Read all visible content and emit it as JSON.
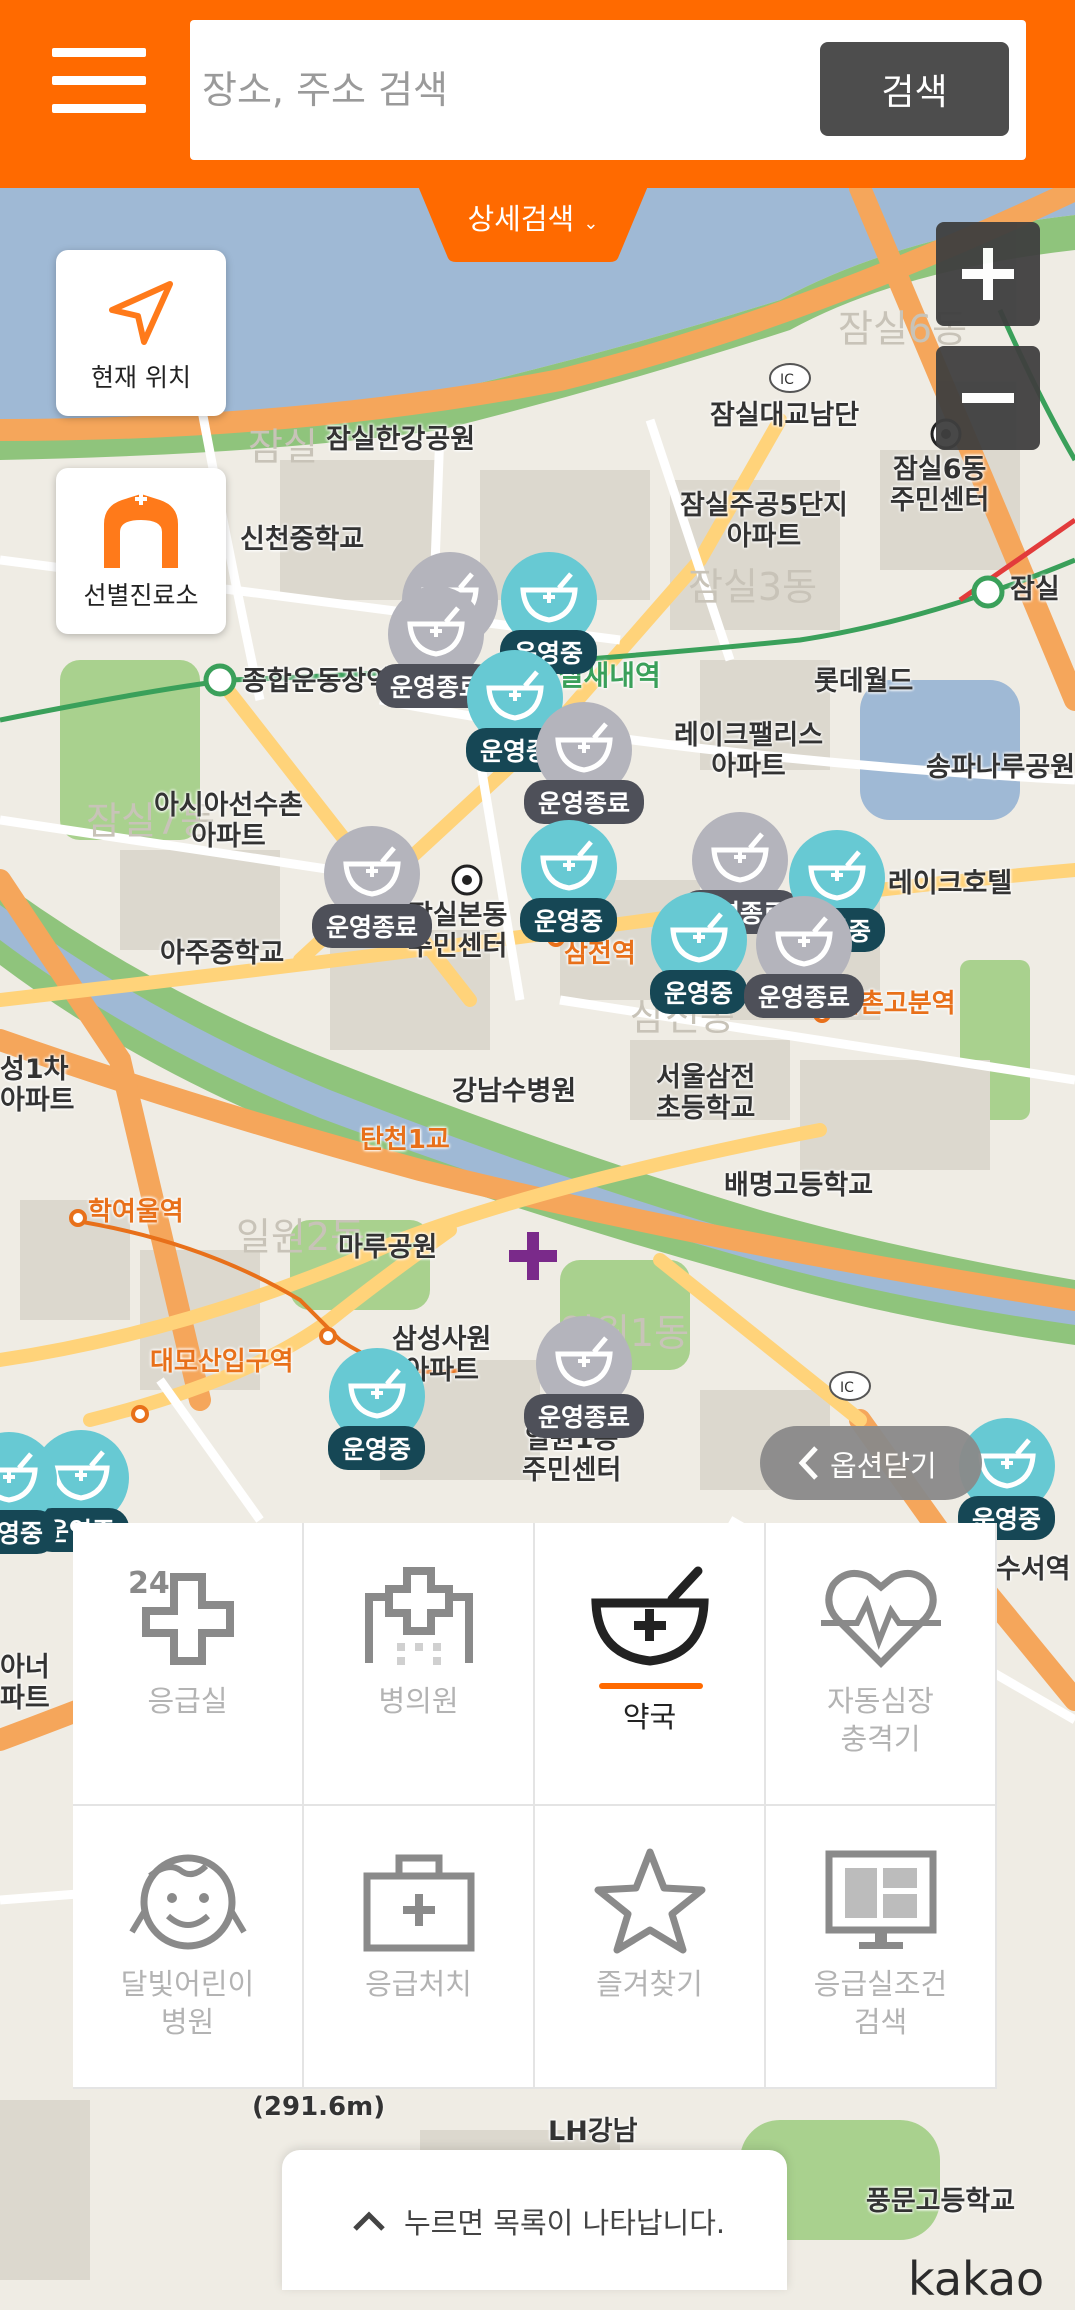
{
  "header": {
    "menu_icon": "hamburger-menu-icon",
    "search_placeholder": "장소, 주소 검색",
    "search_button": "검색",
    "detail_search": "상세검색"
  },
  "controls": {
    "current_location": "현재 위치",
    "screening_clinic": "선별진료소",
    "zoom_in": "+",
    "zoom_out": "−",
    "option_close": "옵션닫기"
  },
  "map": {
    "labels": [
      "잠실한강공원",
      "잠실대교남단",
      "잠실6동\n주민센터",
      "신천중학교",
      "잠실주공5단지\n아파트",
      "종합운동장역",
      "잠실새내역",
      "롯데월드",
      "레이크팰리스\n아파트",
      "송파나루공원",
      "아시아선수촌\n아파트",
      "레이크호텔",
      "아주중학교",
      "잠실본동\n주민센터",
      "삼전역",
      "석촌고분역",
      "서울삼전\n초등학교",
      "강남수병원",
      "배명고등학교",
      "학여울역",
      "마루공원",
      "대모산입구역",
      "삼성사원\n아파트",
      "일원1동\n주민센터",
      "탄천1교",
      "수서역",
      "풍문고등학교",
      "성1차\n아파트",
      "아너\n파트",
      "LH강남",
      "잠실"
    ],
    "faint_labels": [
      "잠실6동",
      "잠실",
      "잠실3동",
      "잠실7동",
      "삼전동",
      "일원2동",
      "일원1동"
    ],
    "distance": "(291.6m)",
    "watermark": "kakao"
  },
  "pins": [
    {
      "status": "운영중"
    },
    {
      "status": "운영종료"
    },
    {
      "status": "운영중"
    },
    {
      "status": "운영종료"
    },
    {
      "status": "운영종료"
    },
    {
      "status": "운영중"
    },
    {
      "status": "운영종료"
    },
    {
      "status": "운영중"
    },
    {
      "status": "운영중"
    },
    {
      "status": "운영종료"
    },
    {
      "status": "운영중"
    },
    {
      "status": "운영종료"
    },
    {
      "status": "운영중"
    },
    {
      "status": "운영중"
    },
    {
      "status": "운영중"
    }
  ],
  "categories": [
    {
      "label": "응급실",
      "icon": "emergency-24-icon",
      "active": false
    },
    {
      "label": "병의원",
      "icon": "hospital-icon",
      "active": false
    },
    {
      "label": "약국",
      "icon": "pharmacy-bowl-icon",
      "active": true
    },
    {
      "label": "자동심장\n충격기",
      "icon": "heart-defibrillator-icon",
      "active": false
    },
    {
      "label": "달빛어린이\n병원",
      "icon": "child-face-icon",
      "active": false
    },
    {
      "label": "응급처치",
      "icon": "first-aid-kit-icon",
      "active": false
    },
    {
      "label": "즐겨찾기",
      "icon": "star-icon",
      "active": false
    },
    {
      "label": "응급실조건\n검색",
      "icon": "monitor-icon",
      "active": false
    }
  ],
  "list_toggle": "누르면 목록이 나타납니다.",
  "colors": {
    "brand": "#ff6a00",
    "open_pin": "#67c9d3",
    "open_tag": "#164755",
    "closed_pin": "#b4b4bc"
  }
}
